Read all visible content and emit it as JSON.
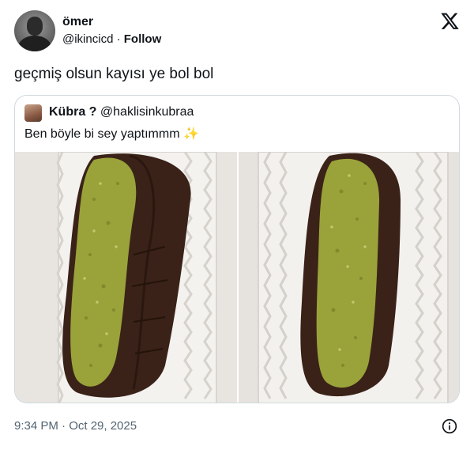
{
  "author": {
    "name": "ömer",
    "handle": "@ikincicd",
    "separator": "·",
    "follow_label": "Follow"
  },
  "tweet": {
    "text": "geçmiş olsun kayısı ye bol bol"
  },
  "quoted": {
    "name": "Kübra ?",
    "handle": "@haklisinkubraa",
    "text": "Ben böyle bi sey yaptımmm ✨"
  },
  "footer": {
    "timestamp": "9:34 PM · Oct 29, 2025"
  },
  "icons": {
    "logo": "x-logo-icon",
    "info": "info-icon"
  },
  "colors": {
    "text": "#0f1419",
    "secondary": "#536471",
    "border": "#cfd9de",
    "chocolate": "#3a2218",
    "pistachio": "#9aa23a"
  }
}
